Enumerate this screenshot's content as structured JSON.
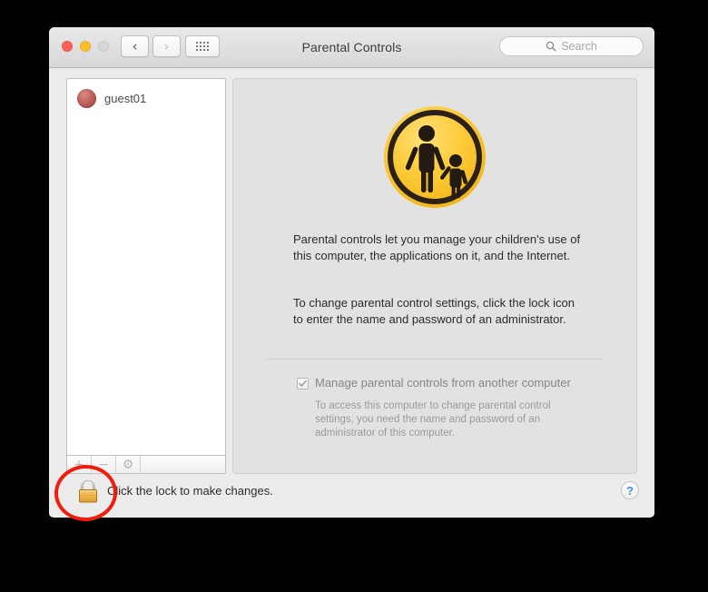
{
  "window": {
    "title": "Parental Controls",
    "traffic_lights": [
      "close",
      "minimize",
      "zoom"
    ]
  },
  "toolbar": {
    "back_label": "‹",
    "forward_label": "›",
    "grid_label": "Show All",
    "search": {
      "placeholder": "Search",
      "value": "",
      "icon": "search-icon"
    }
  },
  "sidebar": {
    "users": [
      {
        "name": "guest01",
        "avatar": "user-avatar"
      }
    ],
    "footer_buttons": [
      {
        "name": "add",
        "glyph": "+"
      },
      {
        "name": "remove",
        "glyph": "−"
      },
      {
        "name": "settings",
        "glyph": "⚙"
      }
    ]
  },
  "content": {
    "hero_icon": "parental-controls-icon",
    "paragraphs": [
      "Parental controls let you manage your children's use of this computer, the applications on it, and the Internet.",
      "To change parental control settings, click the lock icon to enter the name and password of an administrator."
    ],
    "checkbox": {
      "label": "Manage parental controls from another computer",
      "checked": true,
      "enabled": false
    },
    "sub_note": "To access this computer to change parental control settings, you need the name and password of an administrator of this computer."
  },
  "bottom_bar": {
    "lock_icon": "locked-padlock-icon",
    "lock_caption": "Click the lock to make changes.",
    "help_label": "?"
  },
  "annotation": {
    "shape": "ellipse",
    "color": "#f01c0c",
    "target": "lock-button"
  },
  "colors": {
    "accent_yellow": "#fbc823",
    "annotation_red": "#f01c0c",
    "help_blue": "#3b8ef0",
    "window_bg": "#ececec",
    "panel_bg": "#e2e2e2"
  }
}
